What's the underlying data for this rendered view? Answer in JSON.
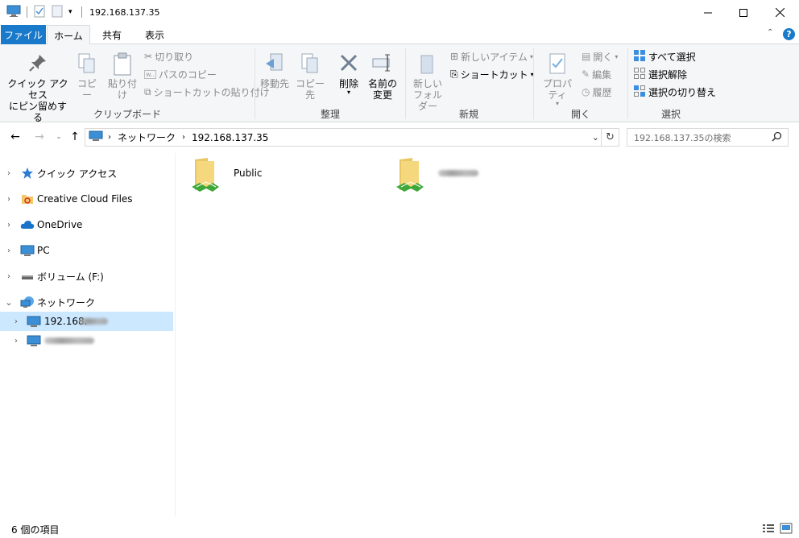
{
  "window": {
    "title": "192.168.137.35",
    "controls": {
      "minimize": "—",
      "maximize": "☐",
      "close": "✕"
    }
  },
  "ribbon_tabs": {
    "file": "ファイル",
    "home": "ホーム",
    "share": "共有",
    "view": "表示"
  },
  "ribbon": {
    "clipboard": {
      "label": "クリップボード",
      "pin_line1": "クイック アクセス",
      "pin_line2": "にピン留めする",
      "copy": "コピー",
      "paste": "貼り付け",
      "cut": "切り取り",
      "copy_path": "パスのコピー",
      "paste_shortcut": "ショートカットの貼り付け"
    },
    "organize": {
      "label": "整理",
      "move_to": "移動先",
      "copy_to": "コピー先",
      "delete": "削除",
      "rename_line1": "名前の",
      "rename_line2": "変更"
    },
    "new": {
      "label": "新規",
      "new_folder_line1": "新しい",
      "new_folder_line2": "フォルダー",
      "new_item": "新しいアイテム",
      "easy_access": "ショートカット"
    },
    "open": {
      "label": "開く",
      "properties": "プロパティ",
      "open": "開く",
      "edit": "編集",
      "history": "履歴"
    },
    "select": {
      "label": "選択",
      "select_all": "すべて選択",
      "select_none": "選択解除",
      "invert": "選択の切り替え"
    }
  },
  "address": {
    "segments": [
      "ネットワーク",
      "192.168.137.35"
    ],
    "search_placeholder": "192.168.137.35の検索"
  },
  "nav": {
    "items": [
      {
        "label": "クイック アクセス"
      },
      {
        "label": "Creative Cloud Files"
      },
      {
        "label": "OneDrive"
      },
      {
        "label": "PC"
      },
      {
        "label": "ボリューム (F:)"
      },
      {
        "label": "ネットワーク"
      },
      {
        "label": "192.168."
      }
    ]
  },
  "content": {
    "items": [
      {
        "name": "Public"
      }
    ]
  },
  "status": {
    "count": "6 個の項目"
  },
  "colors": {
    "accent": "#1979ca",
    "selected": "#cce8ff",
    "ribbon_bg": "#f5f6f7"
  }
}
